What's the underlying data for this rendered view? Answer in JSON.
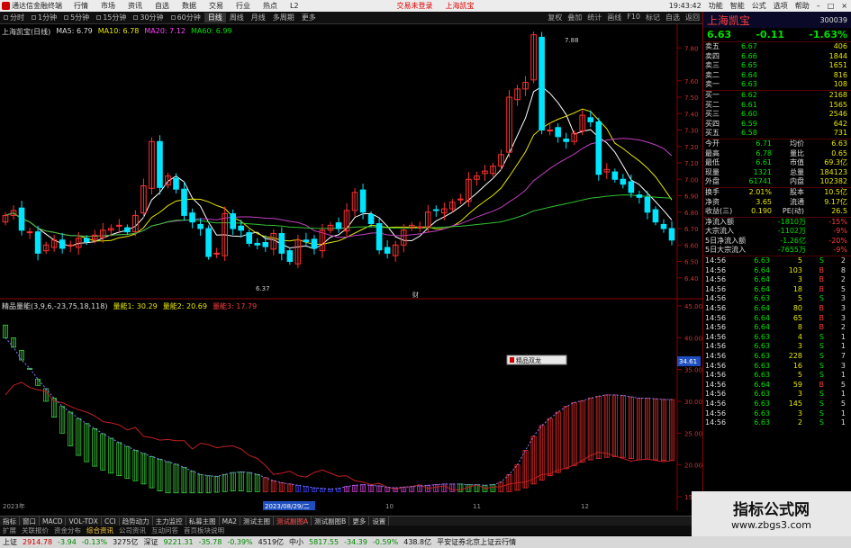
{
  "menubar": {
    "app_title": "通达信金融终端",
    "items": [
      "行情",
      "市场",
      "资讯",
      "自选",
      "数据",
      "交易",
      "行业",
      "热点",
      "L2"
    ],
    "center_items": [
      "交易未登录",
      "上海凯宝"
    ],
    "right_items": [
      "功能",
      "智能",
      "公式",
      "选项",
      "帮助"
    ],
    "clock": "19:43:42"
  },
  "toolbar": {
    "tabs": [
      "分时",
      "1分钟",
      "5分钟",
      "15分钟",
      "30分钟",
      "60分钟",
      "日线",
      "周线",
      "月线",
      "多周期",
      "更多"
    ],
    "active_tab": "日线",
    "tools": [
      "复权",
      "叠加",
      "统计",
      "画线",
      "F10",
      "标记",
      "自选",
      "返回"
    ]
  },
  "chart_legend": {
    "title": "上海凯宝(日线)",
    "ma5": "MA5: 6.79",
    "ma10": "MA10: 6.78",
    "ma20": "MA20: 7.12",
    "ma60": "MA60: 6.99"
  },
  "indicator_legend": {
    "name": "精品量能(3,9,6,-23,75,18,118)",
    "v1": "量能1: 30.29",
    "v2": "量能2: 20.69",
    "v3": "量能3: 17.79"
  },
  "price_axis": [
    "7.80",
    "7.60",
    "7.50",
    "7.40",
    "7.30",
    "7.20",
    "7.10",
    "7.00",
    "6.90",
    "6.80",
    "6.70",
    "6.60",
    "6.50",
    "6.40"
  ],
  "ind_axis": [
    "45.00",
    "40.00",
    "35.00",
    "30.00",
    "25.00",
    "20.00",
    "15.00"
  ],
  "annotations": {
    "high": "7.88",
    "low": "6.37",
    "marker": "财",
    "popup": "精品双龙",
    "ind_readout": "34.61"
  },
  "date_axis": [
    "2023年",
    "2023/08/29/二",
    "10",
    "11",
    "12"
  ],
  "info": {
    "name": "上海凯宝",
    "code": "300039",
    "price": "6.63",
    "change": "-0.11",
    "change_pct": "-1.63%",
    "asks": [
      {
        "label": "卖五",
        "price": "6.67",
        "vol": "406"
      },
      {
        "label": "卖四",
        "price": "6.66",
        "vol": "1844"
      },
      {
        "label": "卖三",
        "price": "6.65",
        "vol": "1651"
      },
      {
        "label": "卖二",
        "price": "6.64",
        "vol": "816"
      },
      {
        "label": "卖一",
        "price": "6.63",
        "vol": "108"
      }
    ],
    "bids": [
      {
        "label": "买一",
        "price": "6.62",
        "vol": "2168"
      },
      {
        "label": "买二",
        "price": "6.61",
        "vol": "1565"
      },
      {
        "label": "买三",
        "price": "6.60",
        "vol": "2546"
      },
      {
        "label": "买四",
        "price": "6.59",
        "vol": "642"
      },
      {
        "label": "买五",
        "price": "6.58",
        "vol": "731"
      }
    ],
    "stats": [
      {
        "l1": "今开",
        "v1": "6.71",
        "l2": "均价",
        "v2": "6.63"
      },
      {
        "l1": "最高",
        "v1": "6.78",
        "l2": "量比",
        "v2": "0.65"
      },
      {
        "l1": "最低",
        "v1": "6.61",
        "l2": "市值",
        "v2": "69.3亿"
      },
      {
        "l1": "现量",
        "v1": "1321",
        "l2": "总量",
        "v2": "184123"
      },
      {
        "l1": "外盘",
        "v1": "61741",
        "l2": "内盘",
        "v2": "102382"
      }
    ],
    "stats2": [
      {
        "l1": "换手",
        "v1": "2.01%",
        "l2": "股本",
        "v2": "10.5亿"
      },
      {
        "l1": "净资",
        "v1": "3.65",
        "l2": "流通",
        "v2": "9.17亿"
      },
      {
        "l1": "收益(三)",
        "v1": "0.190",
        "l2": "PE(动)",
        "v2": "26.5"
      }
    ],
    "flows": [
      {
        "label": "净流入额",
        "value": "-1810万",
        "pct": "-15%"
      },
      {
        "label": "大宗流入",
        "value": "-1102万",
        "pct": "-9%"
      },
      {
        "label": "5日净流入额",
        "value": "-1.26亿",
        "pct": "-20%"
      },
      {
        "label": "5日大宗流入",
        "value": "-7655万",
        "pct": "-9%"
      }
    ],
    "ticks": [
      {
        "t": "14:56",
        "p": "6.63",
        "v": "5",
        "d": "S",
        "n": "2"
      },
      {
        "t": "14:56",
        "p": "6.64",
        "v": "103",
        "d": "B",
        "n": "8"
      },
      {
        "t": "14:56",
        "p": "6.64",
        "v": "3",
        "d": "B",
        "n": "2"
      },
      {
        "t": "14:56",
        "p": "6.64",
        "v": "18",
        "d": "B",
        "n": "5"
      },
      {
        "t": "14:56",
        "p": "6.63",
        "v": "5",
        "d": "S",
        "n": "3"
      },
      {
        "t": "14:56",
        "p": "6.64",
        "v": "80",
        "d": "B",
        "n": "3"
      },
      {
        "t": "14:56",
        "p": "6.64",
        "v": "65",
        "d": "B",
        "n": "3"
      },
      {
        "t": "14:56",
        "p": "6.64",
        "v": "8",
        "d": "B",
        "n": "2"
      },
      {
        "t": "14:56",
        "p": "6.63",
        "v": "4",
        "d": "S",
        "n": "1"
      },
      {
        "t": "14:56",
        "p": "6.63",
        "v": "3",
        "d": "S",
        "n": "1"
      },
      {
        "t": "14:56",
        "p": "6.63",
        "v": "228",
        "d": "S",
        "n": "7"
      },
      {
        "t": "14:56",
        "p": "6.63",
        "v": "16",
        "d": "S",
        "n": "3"
      },
      {
        "t": "14:56",
        "p": "6.63",
        "v": "5",
        "d": "S",
        "n": "1"
      },
      {
        "t": "14:56",
        "p": "6.64",
        "v": "59",
        "d": "B",
        "n": "5"
      },
      {
        "t": "14:56",
        "p": "6.63",
        "v": "3",
        "d": "S",
        "n": "1"
      },
      {
        "t": "14:56",
        "p": "6.63",
        "v": "145",
        "d": "S",
        "n": "5"
      },
      {
        "t": "14:56",
        "p": "6.63",
        "v": "3",
        "d": "S",
        "n": "1"
      },
      {
        "t": "14:56",
        "p": "6.63",
        "v": "2",
        "d": "S",
        "n": "1"
      }
    ]
  },
  "indicator_tabs": [
    "指标",
    "窗口",
    "MACD",
    "VOL-TDX",
    "CCI",
    "趋势动力",
    "主力监控",
    "私募主图",
    "MA2",
    "测试主图",
    "测试副图A",
    "测试副图B",
    "更多",
    "设置"
  ],
  "indicator_active": "测试副图A",
  "sub_tabs": [
    "扩展",
    "关联报价",
    "资金分布",
    "综合资讯",
    "公司资讯",
    "互动问答",
    "首页板块说明"
  ],
  "sub_active": "综合资讯",
  "status": {
    "sh_label": "上证",
    "sh_val": "2914.78",
    "sh_chg": "-3.94",
    "sh_pct": "-0.13%",
    "sh_amt": "3275亿",
    "sz_label": "深证",
    "sz_val": "9221.31",
    "sz_chg": "-35.78",
    "sz_pct": "-0.39%",
    "sz_amt": "4519亿",
    "zx_label": "中小",
    "zx_val": "5817.55",
    "zx_chg": "-34.39",
    "zx_pct": "-0.59%",
    "zx_amt": "438.8亿",
    "broker": "平安证券北京上证云行情"
  },
  "watermark": {
    "cn": "指标公式网",
    "url": "www.zbgs3.com"
  },
  "colors": {
    "up": "#ff3030",
    "down": "#00e5ff",
    "ma5": "#ffffff",
    "ma10": "#e6e600",
    "ma20": "#c040c0",
    "ma60": "#30c030"
  },
  "chart_data": [
    {
      "type": "candlestick",
      "ylim": [
        6.3,
        7.9
      ],
      "closes": [
        6.78,
        6.81,
        6.69,
        6.68,
        6.55,
        6.6,
        6.63,
        6.58,
        6.6,
        6.64,
        6.62,
        6.66,
        6.69,
        6.7,
        6.72,
        6.68,
        6.78,
        6.96,
        7.23,
        6.95,
        7.02,
        6.94,
        6.78,
        6.74,
        6.7,
        6.53,
        6.55,
        6.79,
        6.7,
        6.69,
        6.61,
        6.6,
        6.59,
        6.67,
        6.55,
        6.5,
        6.63,
        6.62,
        6.58,
        6.69,
        6.72,
        6.7,
        6.81,
        6.92,
        6.8,
        6.73,
        6.57,
        6.55,
        6.6,
        6.69,
        6.72,
        6.71,
        6.8,
        6.81,
        6.82,
        6.86,
        6.88,
        7.0,
        7.02,
        7.05,
        7.08,
        7.15,
        7.5,
        7.55,
        7.59,
        7.88,
        7.3,
        7.3,
        7.26,
        7.23,
        7.28,
        7.39,
        7.35,
        7.03,
        7.06,
        7.0,
        6.97,
        6.92,
        6.89,
        6.8,
        6.74,
        6.7,
        6.63
      ]
    },
    {
      "type": "indicator",
      "ylim": [
        15,
        45
      ],
      "line1": [
        31.0,
        32.5,
        33.0,
        32.2,
        31.8,
        31.6,
        30.0,
        29.8,
        29.2,
        28.7,
        28.3,
        27.7,
        26.8,
        26.6,
        26.3,
        25.5,
        25.9,
        24.5,
        24.3,
        23.9,
        24.0,
        23.8,
        23.8,
        22.5,
        23.4,
        23.2,
        22.7,
        22.9,
        23.0,
        22.5,
        21.5,
        21.0,
        19.9,
        18.5,
        18.7,
        19.0,
        18.3,
        18.1,
        18.8,
        19.2,
        18.7,
        18.2,
        18.3,
        17.5,
        17.3,
        16.9,
        17.1,
        16.5,
        16.2,
        16.5,
        16.6,
        16.9,
        16.3,
        16.5,
        16.7,
        16.1,
        16.1,
        16.5,
        16.9,
        16.3,
        16.5,
        16.6,
        17.0,
        17.2,
        17.3,
        17.8,
        18.5,
        18.6,
        19.2,
        19.5,
        20.0,
        20.7,
        21.5,
        22.0,
        21.8,
        21.4,
        21.0,
        20.6,
        20.8,
        20.9,
        20.7,
        20.5,
        20.69
      ],
      "line2": [
        40,
        38.5,
        36.5,
        35.2,
        33.5,
        32.0,
        30.5,
        29.2,
        28.3,
        27.3,
        26.5,
        25.7,
        24.9,
        24.2,
        23.5,
        22.9,
        22.3,
        21.8,
        21.3,
        20.9,
        20.5,
        20.1,
        19.6,
        19.0,
        18.5,
        18.3,
        18.2,
        18.5,
        18.8,
        18.9,
        18.8,
        18.5,
        18.0,
        17.5,
        17.2,
        17.0,
        16.8,
        16.6,
        16.4,
        16.3,
        16.2,
        16.3,
        16.6,
        16.8,
        16.9,
        16.8,
        16.7,
        16.5,
        16.4,
        16.5,
        16.6,
        16.7,
        16.8,
        16.9,
        17.0,
        17.0,
        17.0,
        16.9,
        16.9,
        16.8,
        16.9,
        17.3,
        18.5,
        20.0,
        22.3,
        24.5,
        26.2,
        27.3,
        28.3,
        29.2,
        29.8,
        30.1,
        30.5,
        30.8,
        31.0,
        31.0,
        30.9,
        30.7,
        30.5,
        30.5,
        30.4,
        30.3,
        30.29
      ],
      "fill_low": [
        42,
        40,
        38,
        35,
        32.5,
        30,
        27.5,
        25,
        23,
        21.5,
        20.5,
        19.8,
        19.2,
        18.7,
        18.3,
        17.9,
        17.5,
        17.0,
        16.4,
        15.9,
        15.6,
        15.6,
        15.6,
        15.6,
        15.6,
        15.6,
        15.7,
        15.8,
        15.9,
        15.9,
        15.8,
        15.8,
        15.8,
        15.8,
        15.8,
        15.8,
        15.8,
        15.8,
        15.8,
        15.8,
        15.8,
        15.8,
        15.8,
        15.8,
        15.8,
        15.8,
        15.8,
        15.8,
        15.8,
        15.8,
        15.8,
        15.8,
        15.8,
        15.8,
        15.8,
        15.8,
        15.8,
        15.8,
        15.8,
        15.8,
        15.8,
        15.8,
        15.8,
        16.0,
        16.4,
        17.0,
        17.6,
        18.3,
        18.8,
        19.4,
        19.9,
        20.4,
        20.8,
        21.0,
        21.2,
        21.3,
        21.2,
        21.0,
        20.8,
        20.9,
        20.8,
        20.7,
        20.69
      ]
    }
  ]
}
